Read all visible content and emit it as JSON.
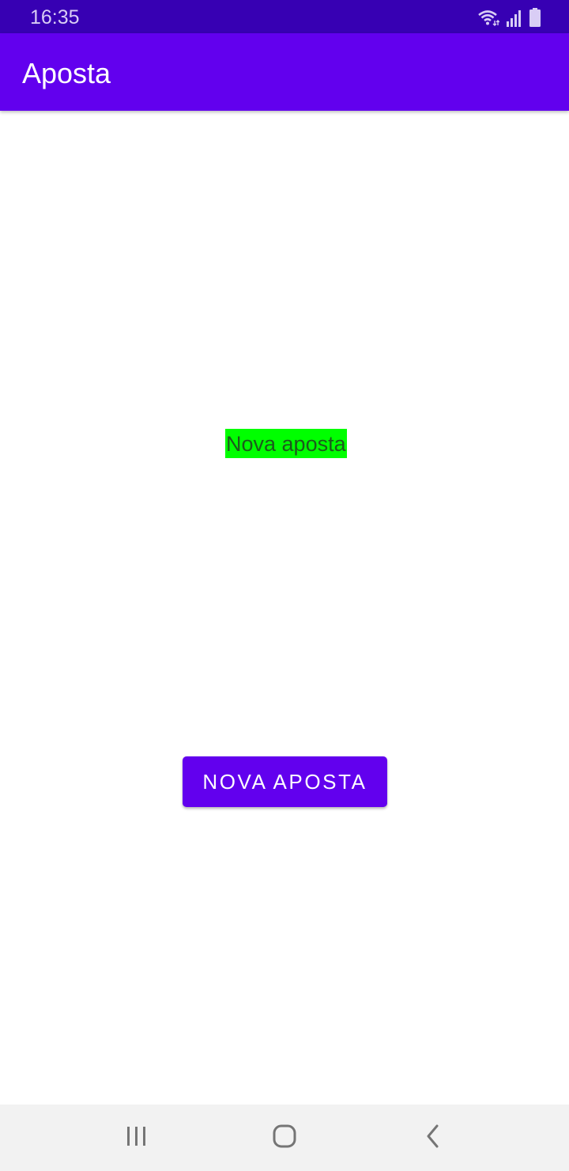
{
  "status_bar": {
    "time": "16:35",
    "icons": [
      "wifi-icon",
      "signal-icon",
      "battery-icon"
    ],
    "background": "#3700b3"
  },
  "app_bar": {
    "title": "Aposta",
    "background": "#6200ee"
  },
  "main": {
    "result_text": "Nova aposta",
    "result_background": "#00ff00",
    "button_label": "Nova aposta"
  },
  "nav_bar": {
    "buttons": [
      "recents-icon",
      "home-icon",
      "back-icon"
    ]
  }
}
